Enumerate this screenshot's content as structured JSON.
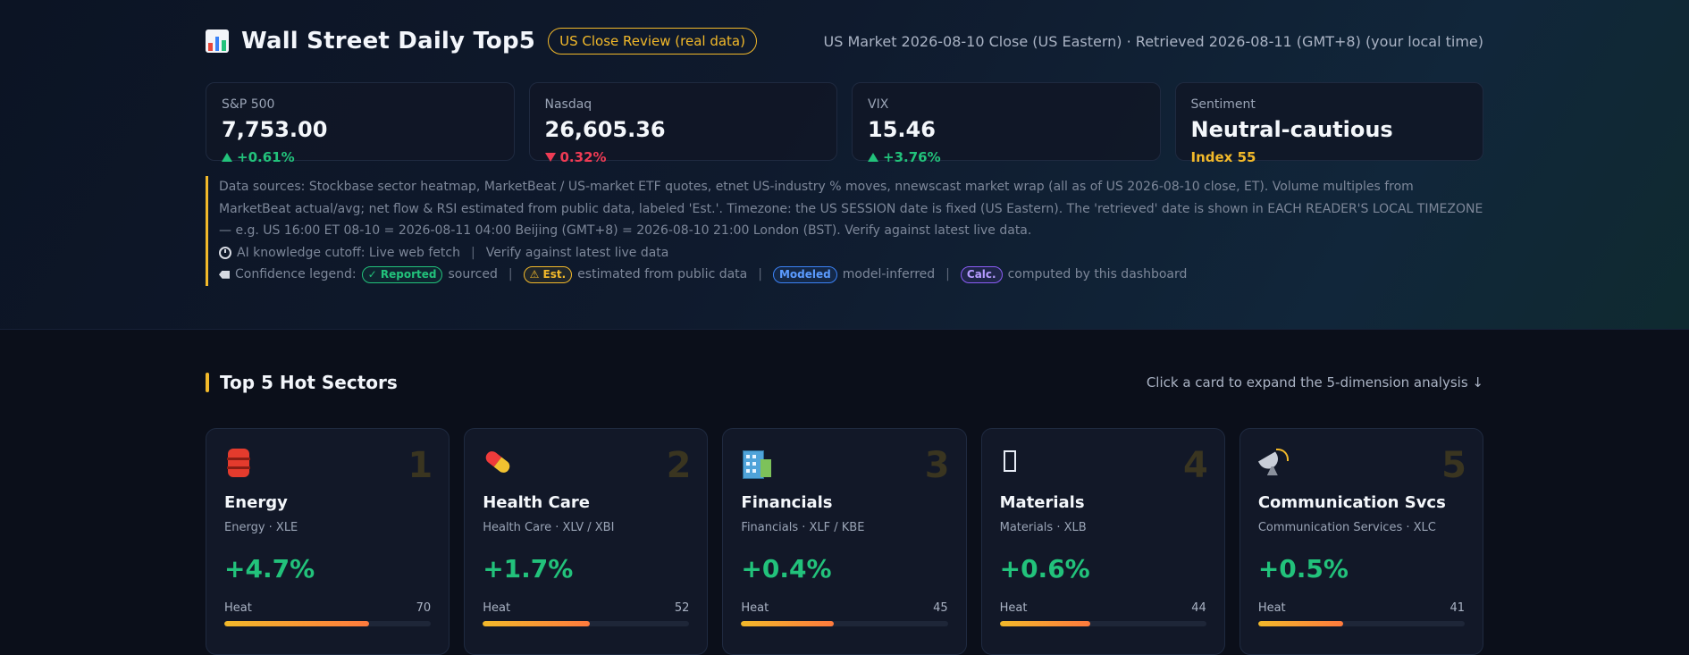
{
  "header": {
    "title": "Wall Street Daily Top5",
    "badge": "US Close Review (real data)",
    "meta": "US Market 2026-08-10 Close (US Eastern) · Retrieved 2026-08-11 (GMT+8) (your local time)"
  },
  "kpis": [
    {
      "label": "S&P 500",
      "value": "7,753.00",
      "change": "+0.61%",
      "direction": "up"
    },
    {
      "label": "Nasdaq",
      "value": "26,605.36",
      "change": "0.32%",
      "direction": "down"
    },
    {
      "label": "VIX",
      "value": "15.46",
      "change": "+3.76%",
      "direction": "up"
    },
    {
      "label": "Sentiment",
      "value": "Neutral-cautious",
      "change": "Index 55",
      "direction": "none"
    }
  ],
  "notes": {
    "sources": "Data sources: Stockbase sector heatmap, MarketBeat / US-market ETF quotes, etnet US-industry % moves, nnewscast market wrap (all as of US 2026-08-10 close, ET). Volume multiples from MarketBeat actual/avg; net flow & RSI estimated from public data, labeled 'Est.'. Timezone: the US SESSION date is fixed (US Eastern). The 'retrieved' date is shown in EACH READER'S LOCAL TIMEZONE — e.g. US 16:00 ET 08-10 = 2026-08-11 04:00 Beijing (GMT+8) = 2026-08-10 21:00 London (BST). Verify against latest live data.",
    "cutoff_a": "AI knowledge cutoff: Live web fetch",
    "cutoff_sep": "|",
    "cutoff_b": "Verify against latest live data",
    "legend_label": "Confidence legend:",
    "legend": [
      {
        "badge": "✓ Reported",
        "text": "sourced"
      },
      {
        "badge": "⚠ Est.",
        "text": "estimated from public data"
      },
      {
        "badge": "Modeled",
        "text": "model-inferred"
      },
      {
        "badge": "Calc.",
        "text": "computed by this dashboard"
      }
    ],
    "legend_sep": "|"
  },
  "section": {
    "title": "Top 5 Hot Sectors",
    "hint": "Click a card to expand the 5-dimension analysis ↓"
  },
  "sectors": [
    {
      "rank": "1",
      "icon": "oil-barrel-icon",
      "name": "Energy",
      "sub": "Energy · XLE",
      "change": "+4.7%",
      "heat_label": "Heat",
      "heat": 70
    },
    {
      "rank": "2",
      "icon": "pill-icon",
      "name": "Health Care",
      "sub": "Health Care · XLV / XBI",
      "change": "+1.7%",
      "heat_label": "Heat",
      "heat": 52
    },
    {
      "rank": "3",
      "icon": "office-building-icon",
      "name": "Financials",
      "sub": "Financials · XLF / KBE",
      "change": "+0.4%",
      "heat_label": "Heat",
      "heat": 45
    },
    {
      "rank": "4",
      "icon": "missing-glyph-icon",
      "name": "Materials",
      "sub": "Materials · XLB",
      "change": "+0.6%",
      "heat_label": "Heat",
      "heat": 44
    },
    {
      "rank": "5",
      "icon": "satellite-dish-icon",
      "name": "Communication Svcs",
      "sub": "Communication Services · XLC",
      "change": "+0.5%",
      "heat_label": "Heat",
      "heat": 41
    }
  ],
  "colors": {
    "accent": "#f2b92a",
    "up": "#22c27b",
    "down": "#ef3b54",
    "background": "#0b0f1a"
  }
}
